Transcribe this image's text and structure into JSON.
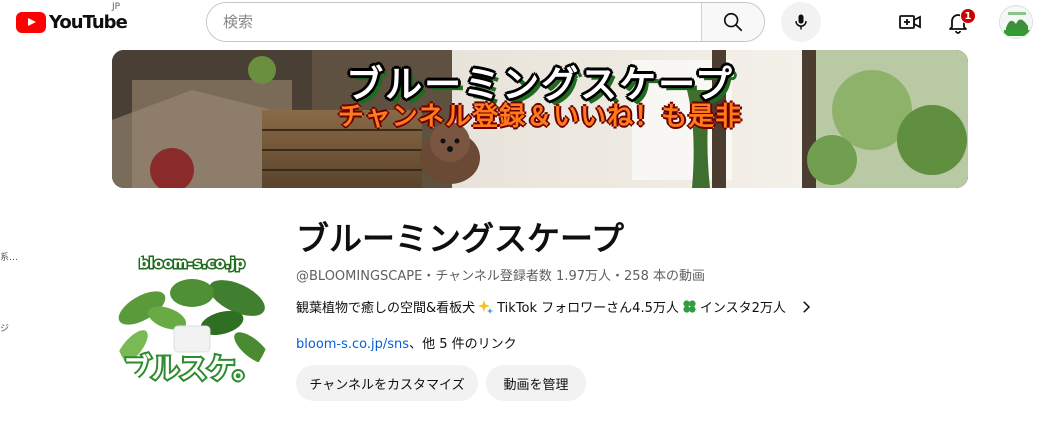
{
  "header": {
    "logo_text": "YouTube",
    "logo_country": "JP",
    "search_placeholder": "検索",
    "notification_count": "1"
  },
  "banner": {
    "title": "ブルーミングスケープ",
    "subtitle": "チャンネル登録＆いいね！も是非"
  },
  "channel": {
    "avatar_text_top": "bloom-s.co.jp",
    "avatar_text_bottom": "ブルスケ。",
    "name": "ブルーミングスケープ",
    "handle": "@BLOOMINGSCAPE",
    "subscribers": "チャンネル登録者数 1.97万人",
    "videos": "258 本の動画",
    "separator": "・",
    "description_part1": "観葉植物で癒しの空間&看板犬",
    "description_part2": "TikTok フォロワーさん4.5万人",
    "description_part3": "インスタ2万人",
    "link": "bloom-s.co.jp/sns",
    "link_suffix": "、他 5 件のリンク",
    "customize_button": "チャンネルをカスタマイズ",
    "manage_button": "動画を管理"
  },
  "left_edge": {
    "fragment1": "系…",
    "fragment2": "ジ"
  },
  "colors": {
    "brand_red": "#ff0000",
    "link_blue": "#065fd4",
    "button_bg": "#f2f2f2",
    "badge_red": "#cc0000",
    "banner_subtitle": "#ff7a1a"
  }
}
